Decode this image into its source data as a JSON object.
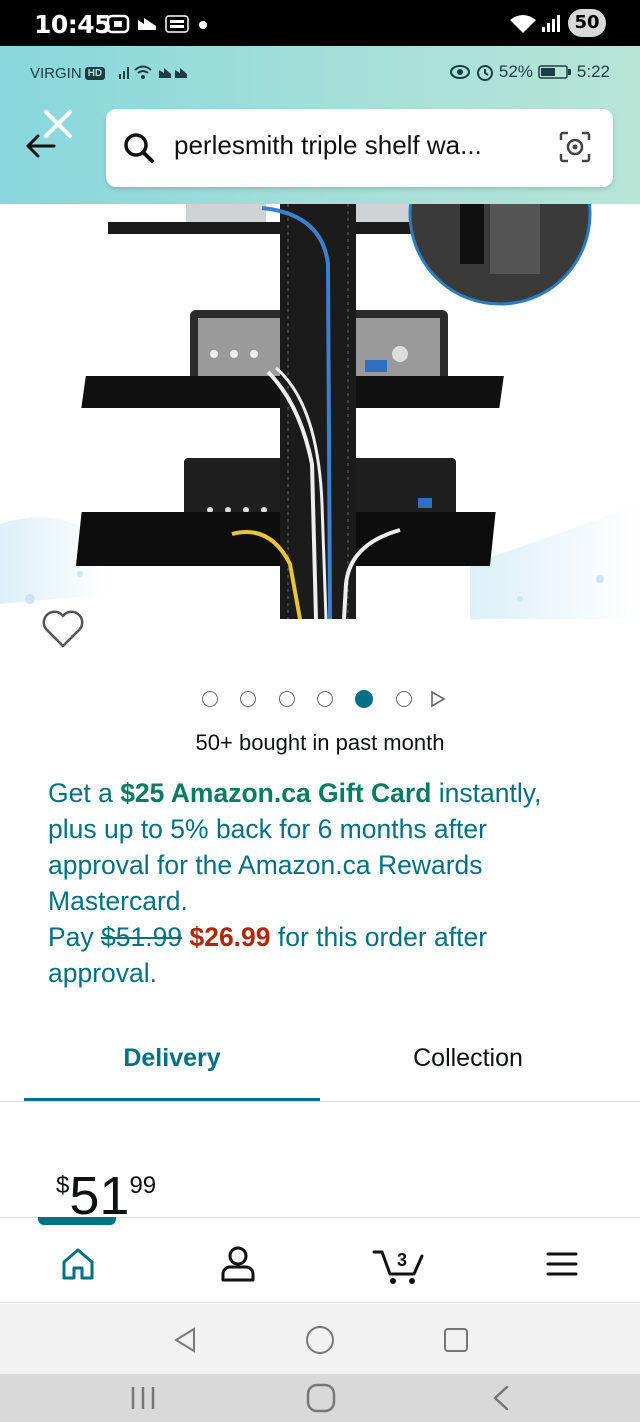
{
  "outer_status": {
    "time": "10:45",
    "battery": "50"
  },
  "inner_status": {
    "carrier": "VIRGIN",
    "hd": "HD",
    "battery_pct": "52%",
    "time": "5:22"
  },
  "search": {
    "query": "perlesmith triple shelf wa..."
  },
  "gallery": {
    "image_count": 6,
    "active_index": 4
  },
  "social_proof": "50+ bought in past month",
  "promo": {
    "p1": "Get a ",
    "gift": "$25 Amazon.ca Gift Card",
    "p2": " instantly, plus up to 5% back for 6 months after approval for the Amazon.ca Rewards Mastercard.",
    "pay": "Pay ",
    "old_price": "$51.99",
    "new_price": "$26.99",
    "p3": " for this order after approval."
  },
  "tabs": [
    {
      "label": "Delivery",
      "active": true
    },
    {
      "label": "Collection",
      "active": false
    }
  ],
  "price": {
    "symbol": "$",
    "whole": "51",
    "fraction": "99"
  },
  "bottom_nav": {
    "cart_count": "3"
  },
  "colors": {
    "teal": "#007185",
    "green": "#067d62",
    "red": "#b12704",
    "header_gradient": "#88d7dc"
  }
}
